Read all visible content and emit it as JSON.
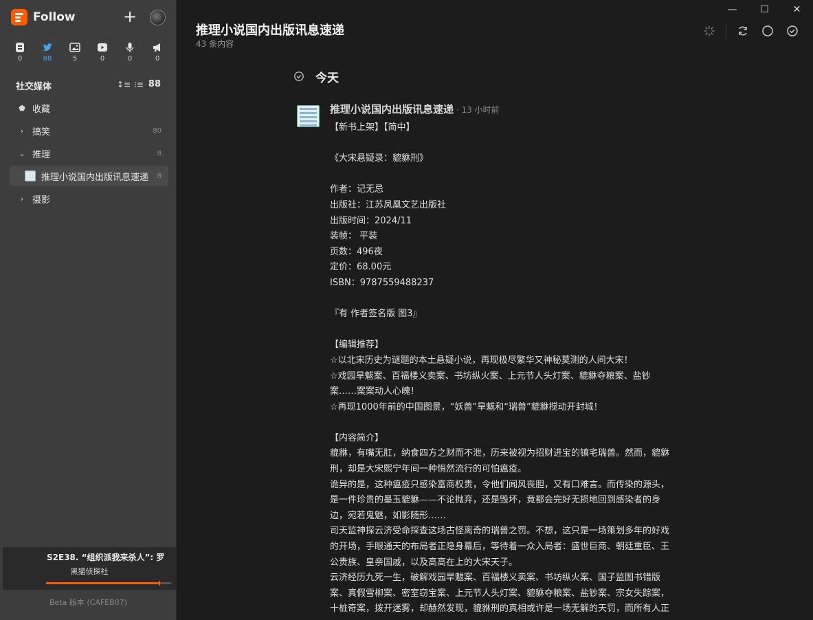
{
  "app": {
    "name": "Follow"
  },
  "views": [
    {
      "icon": "article-icon",
      "count": "0"
    },
    {
      "icon": "twitter-icon",
      "count": "88"
    },
    {
      "icon": "picture-icon",
      "count": "5"
    },
    {
      "icon": "video-icon",
      "count": "0"
    },
    {
      "icon": "microphone-icon",
      "count": "0"
    },
    {
      "icon": "megaphone-icon",
      "count": "0"
    }
  ],
  "sidebar": {
    "section_title": "社交媒体",
    "section_count": "88",
    "items": [
      {
        "label": "收藏",
        "count": ""
      },
      {
        "label": "搞笑",
        "count": "80"
      },
      {
        "label": "推理",
        "count": "8"
      },
      {
        "label": "推理小说国内出版讯息速递",
        "count": "8"
      },
      {
        "label": "摄影",
        "count": ""
      }
    ]
  },
  "player": {
    "title": "S2E38. “组织派我来杀人”: 罗",
    "subtitle": "黑猫侦探社",
    "progress": 0.9
  },
  "version": "Beta 版本 (CAFEB07)",
  "main": {
    "title": "推理小说国内出版讯息速递",
    "subtitle": "43 条内容",
    "day": "今天"
  },
  "entry": {
    "feed": "推理小说国内出版讯息速递",
    "time": " · 13 小时前",
    "lines": [
      "【新书上架】【简中】",
      "",
      "《大宋悬疑录：貔貅刑》",
      "",
      "作者：记无忌",
      "出版社：江苏凤凰文艺出版社",
      "出版时间：2024/11",
      "装帧： 平装",
      "页数：496夜",
      "定价：68.00元",
      "ISBN：9787559488237",
      "",
      "『有 作者签名版 图3』",
      "",
      "【编辑推荐】",
      "☆以北宋历史为谜题的本土悬疑小说，再现极尽繁华又神秘莫测的人间大宋！",
      "☆戏园旱魃案、百福楼义卖案、书坊纵火案、上元节人头灯案、貔貅夺粮案、盐钞",
      "案……案案动人心魄！",
      "☆再现1000年前的中国图景，“妖兽”旱魃和“瑞兽”貔貅搅动开封城！",
      "",
      "【内容简介】",
      "貔貅，有嘴无肛，纳食四方之财而不泄，历来被视为招财进宝的镇宅瑞兽。然而，貔貅",
      "刑，却是大宋熙宁年间一种悄然流行的可怕瘟疫。",
      "诡异的是，这种瘟疫只感染富商权贵，令他们闻风丧胆，又有口难言。而传染的源头，",
      "是一件珍贵的墨玉貔貅——不论抛弃，还是毁坏，竟都会完好无损地回到感染者的身",
      "边，宛若鬼魅，如影随形……",
      "司天监神探云济受命探查这场古怪离奇的瑞兽之罚。不想，这只是一场策划多年的好戏",
      "的开场，手眼通天的布局者正隐身幕后，等待着一众入局者：盛世巨商、朝廷重臣、王",
      "公贵族、皇亲国戚，以及高高在上的大宋天子。",
      "云济经历九死一生，破解戏园旱魃案、百福楼义卖案、书坊纵火案、国子监图书错版",
      "案、真假雪柳案、密室窃宝案、上元节人头灯案、貔貅夺粮案、盐钞案、宗女失踪案，",
      "十桩奇案，拨开迷雾，却赫然发现，貔貅刑的真相或许是一场无解的天罚，而所有人正"
    ]
  }
}
